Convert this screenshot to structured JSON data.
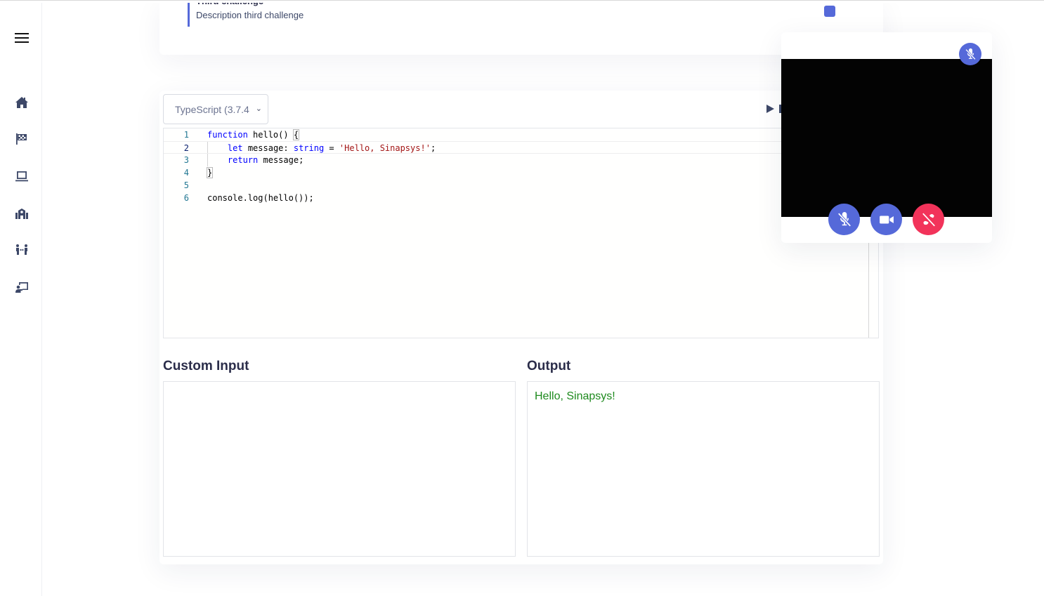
{
  "sidebar": {
    "menu_icon": "hamburger-icon",
    "items": [
      {
        "name": "home",
        "icon": "home-icon"
      },
      {
        "name": "challenges",
        "icon": "checkered-flag-icon"
      },
      {
        "name": "laptop",
        "icon": "laptop-icon"
      },
      {
        "name": "school",
        "icon": "school-icon"
      },
      {
        "name": "people-exchange",
        "icon": "people-arrows-icon"
      },
      {
        "name": "teacher",
        "icon": "chalkboard-teacher-icon"
      }
    ]
  },
  "challenge": {
    "title": "Third challenge",
    "description": "Description third challenge",
    "status_color": "#5569d9"
  },
  "editor": {
    "language_selected": "TypeScript (3.7.4",
    "run_icon": "play-icon",
    "lines": [
      {
        "n": "1"
      },
      {
        "n": "2"
      },
      {
        "n": "3"
      },
      {
        "n": "4"
      },
      {
        "n": "5"
      },
      {
        "n": "6"
      }
    ],
    "code": {
      "l1_kw": "function",
      "l1_rest": " hello() ",
      "l1_brace": "{",
      "l2_indent": "    ",
      "l2_kw": "let",
      "l2_mid": " message: ",
      "l2_type": "string",
      "l2_eq": " = ",
      "l2_str": "'Hello, Sinapsys!'",
      "l2_end": ";",
      "l3_indent": "    ",
      "l3_kw": "return",
      "l3_rest": " message;",
      "l4_brace": "}",
      "l6": "console.log(hello());"
    }
  },
  "io": {
    "input_label": "Custom Input",
    "input_value": "",
    "output_label": "Output",
    "output_value": "Hello, Sinapsys!",
    "output_color": "#1e8a1e"
  },
  "video": {
    "remote_status_icon": "microphone-slash-icon",
    "controls": [
      {
        "name": "mute",
        "icon": "microphone-slash-icon",
        "color": "#5569d9"
      },
      {
        "name": "camera",
        "icon": "video-camera-icon",
        "color": "#5569d9"
      },
      {
        "name": "hang-up",
        "icon": "phone-slash-icon",
        "color": "#f2335a"
      }
    ]
  }
}
